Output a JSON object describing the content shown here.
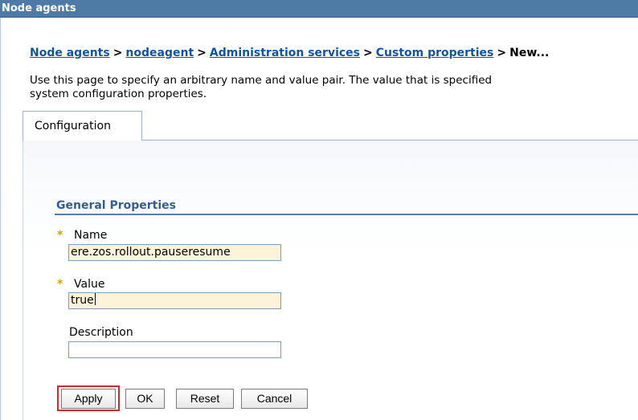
{
  "window": {
    "title": "Node agents"
  },
  "breadcrumb": {
    "items": [
      "Node agents",
      "nodeagent",
      "Administration services",
      "Custom properties"
    ],
    "separator": ">",
    "current": "New..."
  },
  "description": {
    "line1": "Use this page to specify an arbitrary name and value pair. The value that is specified",
    "line2": "system configuration properties."
  },
  "tabs": [
    {
      "label": "Configuration",
      "selected": true
    }
  ],
  "general_properties": {
    "title": "General Properties",
    "name": {
      "label": "Name",
      "value": "ere.zos.rollout.pauseresume",
      "required": true
    },
    "value": {
      "label": "Value",
      "value": "true",
      "required": true
    },
    "description": {
      "label": "Description",
      "value": "",
      "required": false
    }
  },
  "buttons": {
    "apply": "Apply",
    "ok": "OK",
    "reset": "Reset",
    "cancel": "Cancel"
  },
  "required_marker": "*",
  "colors": {
    "title_bar": "#4e7aa6",
    "link": "#10559c",
    "required_field_bg": "#fdf3d8",
    "highlight": "#d8282c"
  }
}
